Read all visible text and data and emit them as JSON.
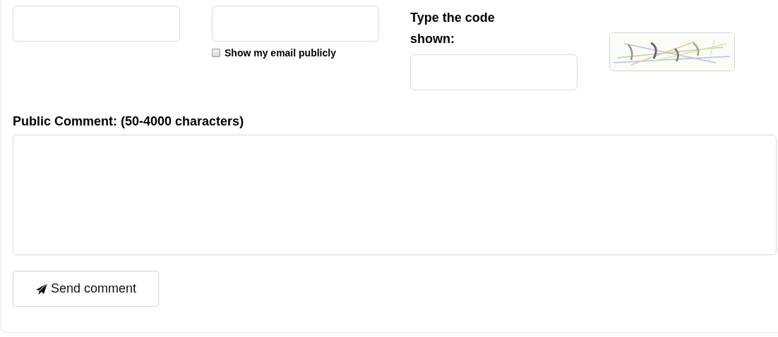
{
  "fields": [
    {
      "kind": "input"
    },
    {
      "kind": "input"
    }
  ],
  "show_email": {
    "label": "Show my email publicly",
    "checked": false
  },
  "captcha": {
    "label": "Type the code shown:"
  },
  "comment": {
    "label": "Public Comment: (50-4000 characters)"
  },
  "send_button": {
    "label": "Send comment"
  }
}
